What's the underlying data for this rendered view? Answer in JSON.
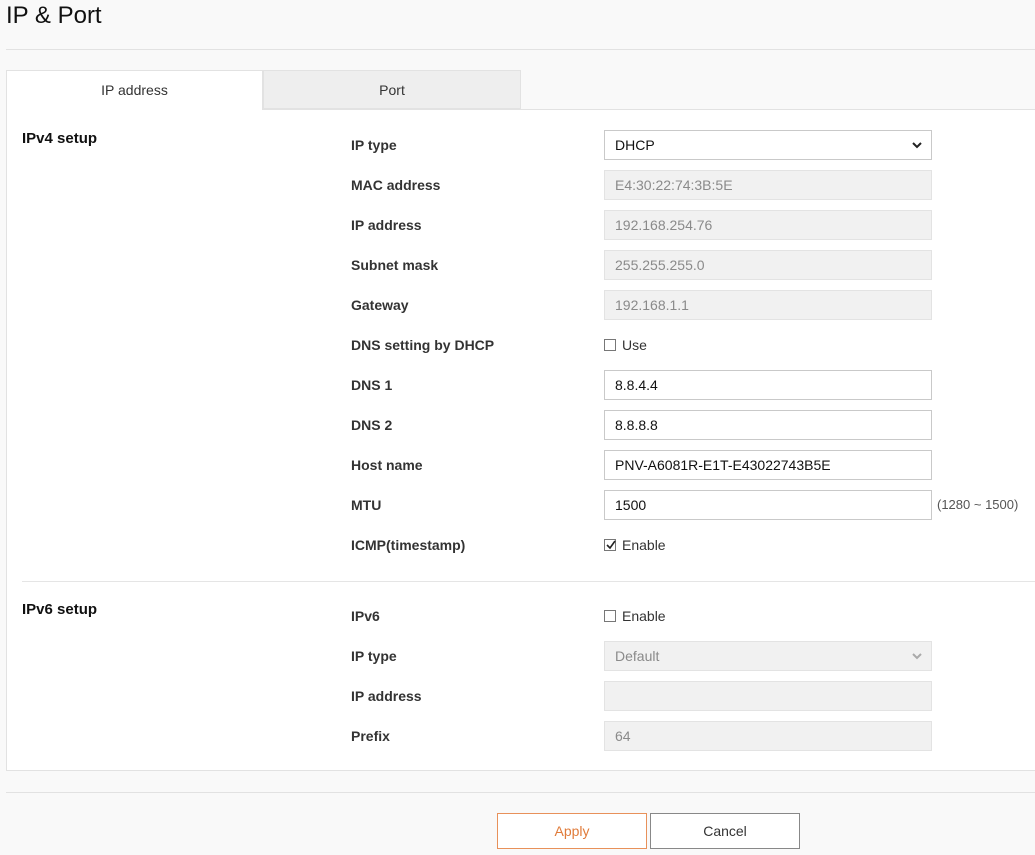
{
  "page": {
    "title": "IP & Port"
  },
  "tabs": [
    {
      "label": "IP address",
      "active": true
    },
    {
      "label": "Port",
      "active": false
    }
  ],
  "ipv4": {
    "title": "IPv4 setup",
    "ip_type": {
      "label": "IP type",
      "value": "DHCP"
    },
    "mac": {
      "label": "MAC address",
      "value": "E4:30:22:74:3B:5E"
    },
    "ip_address": {
      "label": "IP address",
      "value": "192.168.254.76"
    },
    "subnet": {
      "label": "Subnet mask",
      "value": "255.255.255.0"
    },
    "gateway": {
      "label": "Gateway",
      "value": "192.168.1.1"
    },
    "dns_dhcp": {
      "label": "DNS setting by DHCP",
      "option": "Use",
      "checked": false
    },
    "dns1": {
      "label": "DNS 1",
      "value": "8.8.4.4"
    },
    "dns2": {
      "label": "DNS 2",
      "value": "8.8.8.8"
    },
    "hostname": {
      "label": "Host name",
      "value": "PNV-A6081R-E1T-E43022743B5E"
    },
    "mtu": {
      "label": "MTU",
      "value": "1500",
      "hint": "(1280 ~ 1500)"
    },
    "icmp": {
      "label": "ICMP(timestamp)",
      "option": "Enable",
      "checked": true
    }
  },
  "ipv6": {
    "title": "IPv6 setup",
    "enable": {
      "label": "IPv6",
      "option": "Enable",
      "checked": false
    },
    "ip_type": {
      "label": "IP type",
      "value": "Default"
    },
    "ip_address": {
      "label": "IP address",
      "value": ""
    },
    "prefix": {
      "label": "Prefix",
      "value": "64"
    }
  },
  "buttons": {
    "apply": "Apply",
    "cancel": "Cancel"
  },
  "colors": {
    "accent": "#e07b3a",
    "disabled_bg": "#f1f1f1",
    "page_bg": "#f9f9f9"
  }
}
